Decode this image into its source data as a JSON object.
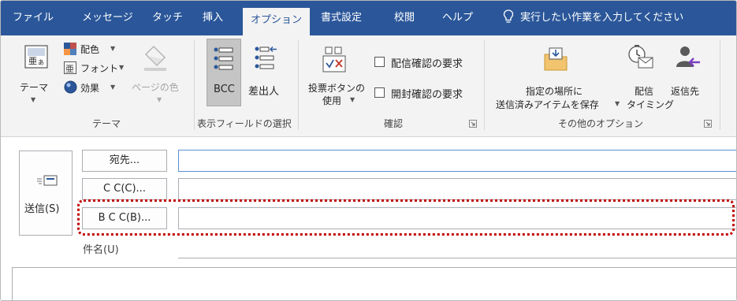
{
  "tabs": [
    {
      "label": "ファイル",
      "active": false
    },
    {
      "label": "メッセージ",
      "active": false
    },
    {
      "label": "タッチ",
      "active": false
    },
    {
      "label": "挿入",
      "active": false
    },
    {
      "label": "オプション",
      "active": true
    },
    {
      "label": "書式設定",
      "active": false
    },
    {
      "label": "校閲",
      "active": false
    },
    {
      "label": "ヘルプ",
      "active": false
    }
  ],
  "tell_me": "実行したい作業を入力してください",
  "ribbon": {
    "themes": {
      "theme_label": "テーマ",
      "colors_label": "配色",
      "fonts_label": "フォント",
      "effects_label": "効果",
      "page_color_label": "ページの色",
      "group_label": "テーマ"
    },
    "show_fields": {
      "bcc_label": "BCC",
      "from_label": "差出人",
      "group_label": "表示フィールドの選択"
    },
    "tracking": {
      "voting_label_1": "投票ボタンの",
      "voting_label_2": "使用",
      "delivery_receipt_label": "配信確認の要求",
      "read_receipt_label": "開封確認の要求",
      "group_label": "確認"
    },
    "more_options": {
      "save_sent_label_1": "指定の場所に",
      "save_sent_label_2": "送信済みアイテムを保存",
      "delay_label_1": "配信",
      "delay_label_2": "タイミング",
      "direct_replies_label": "返信先",
      "group_label": "その他のオプション"
    }
  },
  "compose": {
    "send_label": "送信(S)",
    "to_label": "宛先...",
    "cc_label": "C C(C)...",
    "bcc_label": "B C C(B)...",
    "subject_label": "件名(U)"
  },
  "colors": {
    "tabbar": "#2b579a",
    "highlight": "#c00000"
  }
}
